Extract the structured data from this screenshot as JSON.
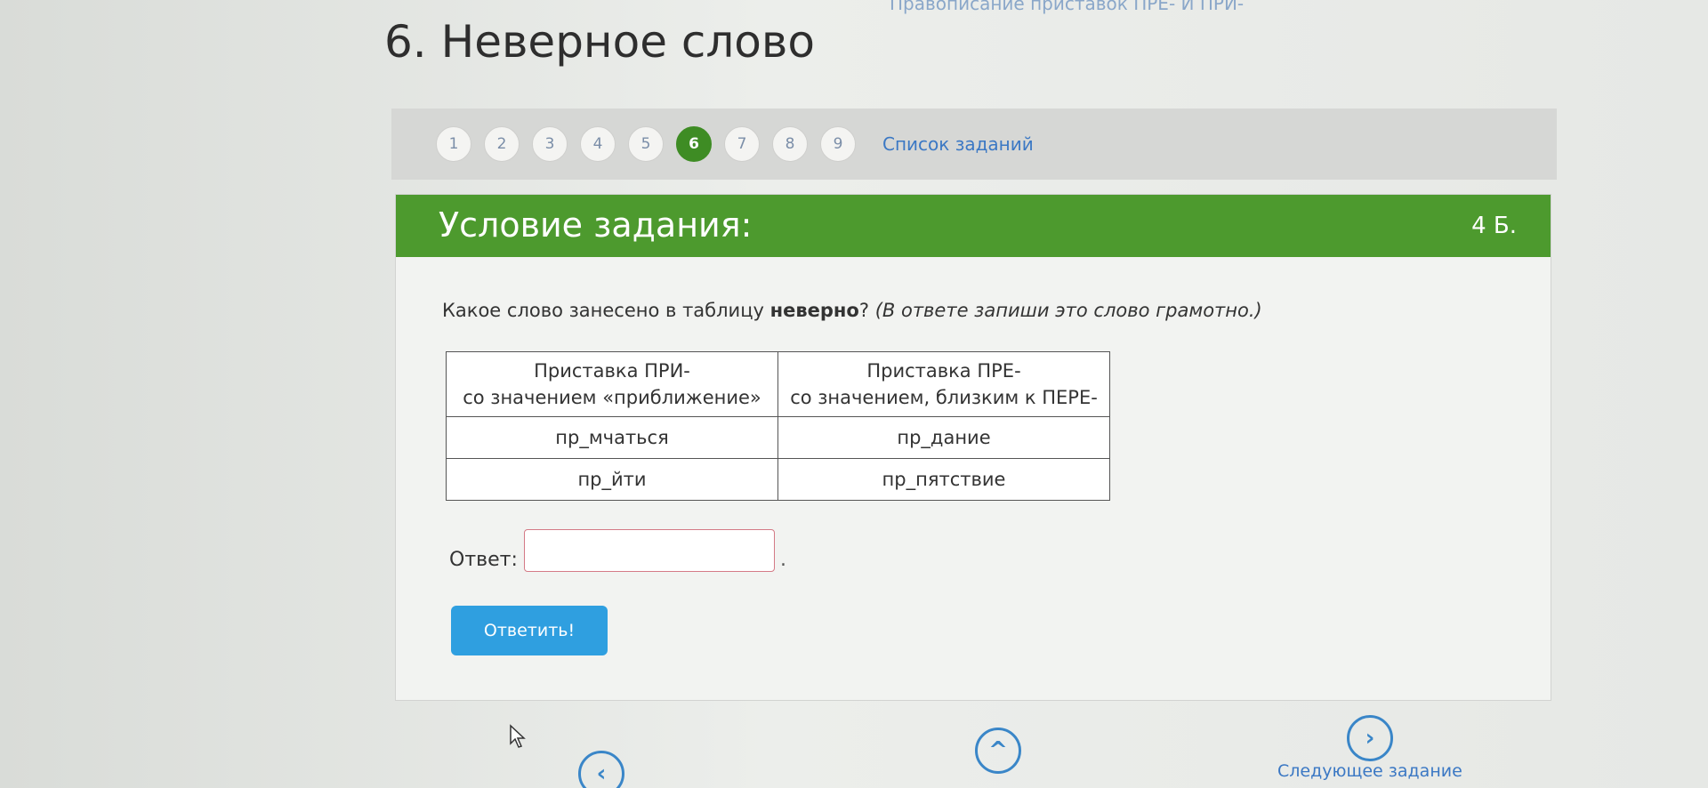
{
  "breadcrumb_text": "Правописание приставок ПРЕ- И ПРИ-",
  "page_title": "6. Неверное слово",
  "nav": {
    "numbers": [
      "1",
      "2",
      "3",
      "4",
      "5",
      "6",
      "7",
      "8",
      "9"
    ],
    "active": "6",
    "list_link": "Список заданий"
  },
  "card": {
    "title": "Условие задания:",
    "points": "4 Б.",
    "question_start": "Какое слово занесено в таблицу ",
    "question_bold": "неверно",
    "question_end": "? ",
    "question_hint": "(В ответе запиши это слово грамотно.)"
  },
  "table": {
    "headers": [
      [
        "Приставка ПРИ-",
        "со значением «приближение»"
      ],
      [
        "Приставка ПРЕ-",
        "со значением, близким к ПЕРЕ-"
      ]
    ],
    "rows": [
      [
        "пр_мчаться",
        "пр_дание"
      ],
      [
        "пр_йти",
        "пр_пятствие"
      ]
    ]
  },
  "answer": {
    "label": "Ответ:",
    "value": "",
    "suffix": "."
  },
  "submit_label": "Ответить!",
  "footer": {
    "next_task_label": "Следующее задание"
  },
  "colors": {
    "accent_green": "#4d9a2e",
    "button_blue": "#2f9fe0",
    "link_blue": "#3b78c4"
  }
}
